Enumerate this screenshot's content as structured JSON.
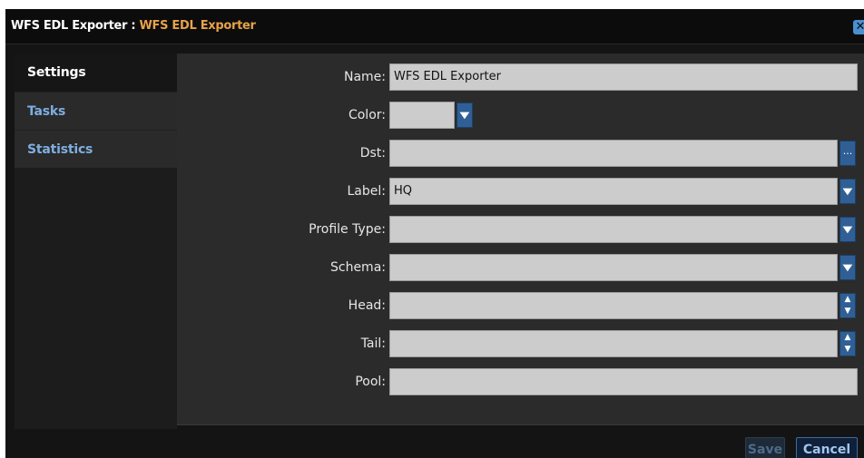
{
  "window": {
    "title_prefix": "WFS EDL Exporter : ",
    "title_accent": "WFS EDL Exporter",
    "close_glyph": "✕"
  },
  "sidebar": {
    "items": [
      {
        "label": "Settings",
        "active": true
      },
      {
        "label": "Tasks",
        "active": false
      },
      {
        "label": "Statistics",
        "active": false
      }
    ]
  },
  "form": {
    "name": {
      "label": "Name:",
      "value": "WFS EDL Exporter"
    },
    "color": {
      "label": "Color:",
      "value": ""
    },
    "dst": {
      "label": "Dst:",
      "value": "",
      "browse_glyph": "···"
    },
    "label_field": {
      "label": "Label:",
      "value": "HQ"
    },
    "profile_type": {
      "label": "Profile Type:",
      "value": ""
    },
    "schema": {
      "label": "Schema:",
      "value": ""
    },
    "head": {
      "label": "Head:",
      "value": ""
    },
    "tail": {
      "label": "Tail:",
      "value": ""
    },
    "pool": {
      "label": "Pool:",
      "value": ""
    }
  },
  "footer": {
    "save_label": "Save",
    "cancel_label": "Cancel"
  },
  "colors": {
    "accent": "#e8a24a",
    "link": "#7eaee0",
    "button": "#2f5f95"
  },
  "icons": {
    "close": "close-icon",
    "dropdown": "chevron-down-icon",
    "browse": "ellipsis-icon",
    "spinner": "up-down-arrows-icon"
  }
}
